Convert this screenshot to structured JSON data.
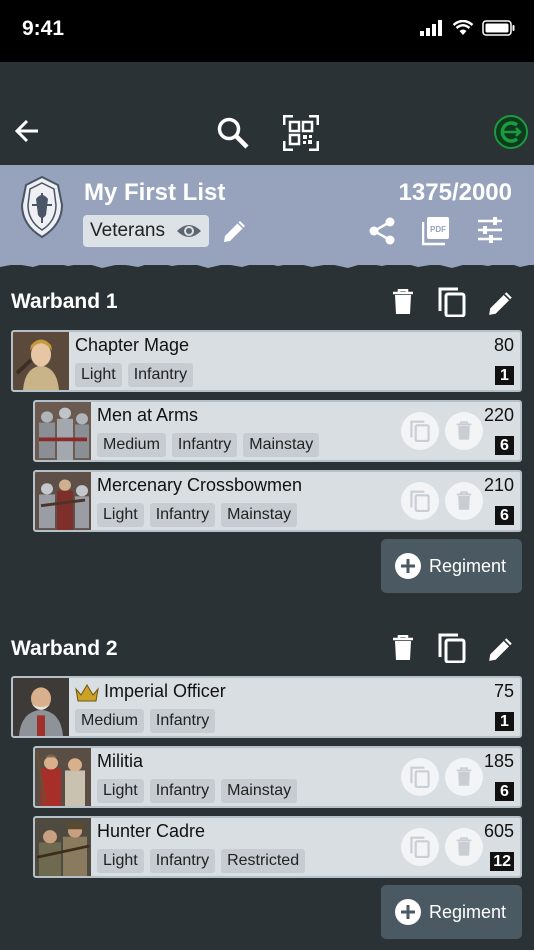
{
  "status": {
    "time": "9:41"
  },
  "header": {
    "title": "My First List",
    "points": "1375/2000",
    "faction": "Veterans"
  },
  "warbands": [
    {
      "title": "Warband 1",
      "leader": {
        "name": "Chapter Mage",
        "points": "80",
        "tags": [
          "Light",
          "Infantry"
        ],
        "count": "1"
      },
      "units": [
        {
          "name": "Men at Arms",
          "points": "220",
          "tags": [
            "Medium",
            "Infantry",
            "Mainstay"
          ],
          "count": "6"
        },
        {
          "name": "Mercenary Crossbowmen",
          "points": "210",
          "tags": [
            "Light",
            "Infantry",
            "Mainstay"
          ],
          "count": "6"
        }
      ],
      "add_label": "Regiment"
    },
    {
      "title": "Warband 2",
      "leader": {
        "name": "Imperial Officer",
        "points": "75",
        "tags": [
          "Medium",
          "Infantry"
        ],
        "count": "1"
      },
      "units": [
        {
          "name": "Militia",
          "points": "185",
          "tags": [
            "Light",
            "Infantry",
            "Mainstay"
          ],
          "count": "6"
        },
        {
          "name": "Hunter Cadre",
          "points": "605",
          "tags": [
            "Light",
            "Infantry",
            "Restricted"
          ],
          "count": "12"
        }
      ],
      "add_label": "Regiment"
    }
  ],
  "icons": {
    "back": "arrow-left-icon",
    "search": "search-icon",
    "qr": "qr-code-icon",
    "logo": "app-logo-icon",
    "crest": "crest-icon",
    "eye": "eye-icon",
    "edit": "pencil-icon",
    "share": "share-icon",
    "pdf": "pdf-icon",
    "settings": "sliders-icon",
    "delete": "trash-icon",
    "copy": "copy-icon",
    "crown": "crown-icon",
    "add": "plus-circle-icon"
  },
  "colors": {
    "background": "#2a3235",
    "header": "#97a3bd",
    "card": "#d9dee3",
    "logo_green": "#1c9a3e"
  }
}
